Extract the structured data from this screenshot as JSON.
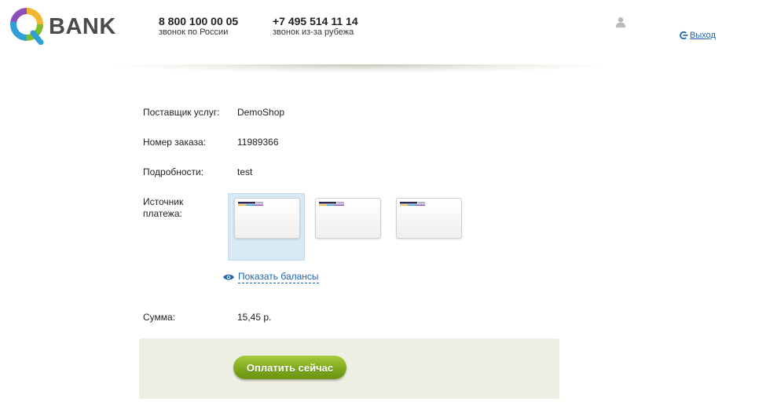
{
  "header": {
    "logo_text": "BANK",
    "phones": [
      {
        "number": "8 800 100 00 05",
        "note": "звонок по России"
      },
      {
        "number": "+7 495 514 11 14",
        "note": "звонок из-за рубежа"
      }
    ],
    "logout_label": "Выход"
  },
  "order": {
    "provider_label": "Поставщик услуг:",
    "provider_value": "DemoShop",
    "order_label": "Номер заказа:",
    "order_value": "11989366",
    "details_label": "Подробности:",
    "details_value": "test",
    "source_label_line1": "Источник",
    "source_label_line2": "платежа:",
    "cards": [
      {
        "selected": true
      },
      {
        "selected": false
      },
      {
        "selected": false
      }
    ],
    "show_balances_label": "Показать балансы",
    "sum_label": "Сумма:",
    "sum_value": "15,45 р."
  },
  "actions": {
    "pay_label": "Оплатить сейчас"
  },
  "colors": {
    "link": "#1a64b0",
    "pay_button": "#8cb52a",
    "selected_card_bg": "#d7e9f4",
    "pay_panel_bg": "#edefe3"
  },
  "icons": [
    "qbank-logo-icon",
    "user-icon",
    "logout-icon",
    "eye-icon"
  ]
}
